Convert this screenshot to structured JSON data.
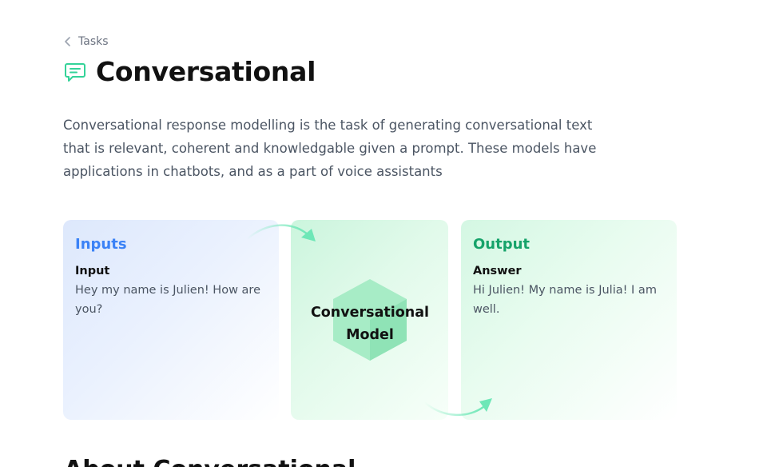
{
  "breadcrumb": {
    "label": "Tasks"
  },
  "page": {
    "title": "Conversational",
    "description": "Conversational response modelling is the task of generating conversational text that is relevant, coherent and knowledgable given a prompt. These models have applications in chatbots, and as a part of voice assistants"
  },
  "widget": {
    "inputs": {
      "heading": "Inputs",
      "field_label": "Input",
      "field_value": "Hey my name is Julien! How are you?"
    },
    "model": {
      "label": "Conversational Model"
    },
    "output": {
      "heading": "Output",
      "field_label": "Answer",
      "field_value": "Hi Julien! My name is Julia! I am well."
    }
  },
  "next_section": {
    "heading": "About Conversational"
  },
  "colors": {
    "inputs_accent": "#3b82f6",
    "output_accent": "#16a36a",
    "model_hexagon": "#a7ecc6",
    "icon_green": "#34d399"
  },
  "icons": [
    "chevron-left-icon",
    "chat-bubble-icon",
    "hexagon-icon",
    "arrow-icon"
  ]
}
